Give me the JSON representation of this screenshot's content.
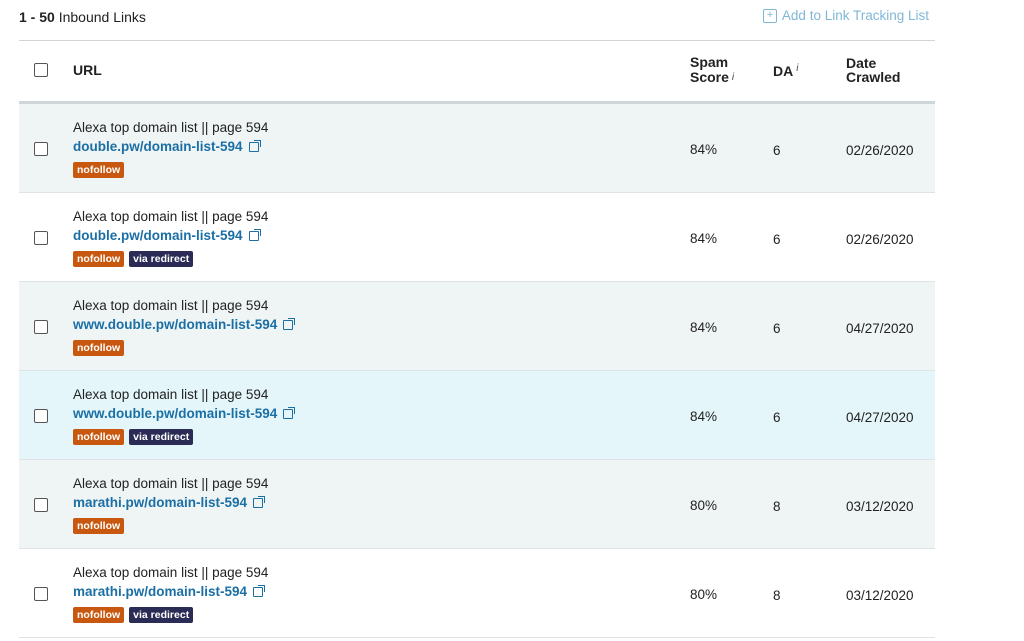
{
  "toolbar": {
    "range": "1 - 50",
    "label": "Inbound Links",
    "add_to_list": "Add to Link Tracking List"
  },
  "columns": {
    "url": "URL",
    "spam_line1": "Spam",
    "spam_line2": "Score",
    "da": "DA",
    "date_line1": "Date",
    "date_line2": "Crawled",
    "info": "i"
  },
  "rows": [
    {
      "title": "Alexa top domain list || page 594",
      "url": "double.pw/domain-list-594",
      "tags": [
        "nofollow"
      ],
      "spam": "84%",
      "da": "6",
      "date": "02/26/2020"
    },
    {
      "title": "Alexa top domain list || page 594",
      "url": "double.pw/domain-list-594",
      "tags": [
        "nofollow",
        "via redirect"
      ],
      "spam": "84%",
      "da": "6",
      "date": "02/26/2020"
    },
    {
      "title": "Alexa top domain list || page 594",
      "url": "www.double.pw/domain-list-594",
      "tags": [
        "nofollow"
      ],
      "spam": "84%",
      "da": "6",
      "date": "04/27/2020"
    },
    {
      "title": "Alexa top domain list || page 594",
      "url": "www.double.pw/domain-list-594",
      "tags": [
        "nofollow",
        "via redirect"
      ],
      "spam": "84%",
      "da": "6",
      "date": "04/27/2020"
    },
    {
      "title": "Alexa top domain list || page 594",
      "url": "marathi.pw/domain-list-594",
      "tags": [
        "nofollow"
      ],
      "spam": "80%",
      "da": "8",
      "date": "03/12/2020"
    },
    {
      "title": "Alexa top domain list || page 594",
      "url": "marathi.pw/domain-list-594",
      "tags": [
        "nofollow",
        "via redirect"
      ],
      "spam": "80%",
      "da": "8",
      "date": "03/12/2020"
    }
  ],
  "colors": {
    "link": "#1a6fa5",
    "nofollow": "#c8580f",
    "redirect": "#2a2c55",
    "row_alt": "#eff4f5",
    "row_highlight": "#e4f6fa"
  },
  "icons": [
    "plus-square-icon",
    "external-link-icon",
    "info-icon",
    "checkbox-icon"
  ]
}
